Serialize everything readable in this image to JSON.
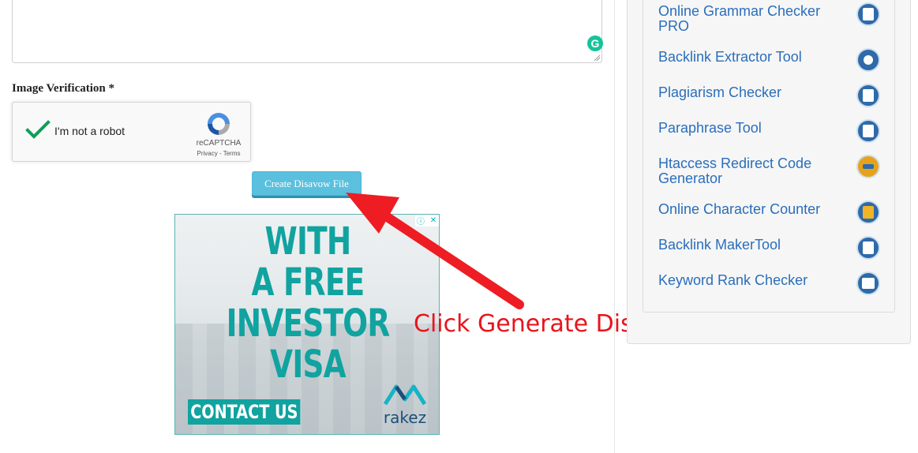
{
  "form": {
    "image_verification_label": "Image Verification *",
    "submit_label": "Create Disavow File"
  },
  "recaptcha": {
    "checkbox_label": "I'm not a robot",
    "brand": "reCAPTCHA",
    "links": "Privacy - Terms",
    "checked": true
  },
  "ad": {
    "headline_lines": [
      "WITH",
      "A FREE",
      "INVESTOR",
      "VISA"
    ],
    "cta": "CONTACT US",
    "advertiser": "rakez",
    "adchoices_icons": [
      "info-icon",
      "close-icon"
    ]
  },
  "annotation": {
    "text": "Click Generate Disavow File",
    "color": "#e8141c"
  },
  "sidebar": {
    "tools": [
      {
        "label": "Online Grammar Checker PRO",
        "icon": "grammar-checker-icon"
      },
      {
        "label": "Backlink Extractor Tool",
        "icon": "backlink-extractor-icon"
      },
      {
        "label": "Plagiarism Checker",
        "icon": "plagiarism-checker-icon"
      },
      {
        "label": "Paraphrase Tool",
        "icon": "paraphrase-tool-icon"
      },
      {
        "label": "Htaccess Redirect Code Generator",
        "icon": "htaccess-redirect-icon"
      },
      {
        "label": "Online Character Counter",
        "icon": "character-counter-icon"
      },
      {
        "label": "Backlink MakerTool",
        "icon": "backlink-maker-icon"
      },
      {
        "label": "Keyword Rank Checker",
        "icon": "keyword-rank-icon"
      }
    ]
  },
  "colors": {
    "button": "#5bc0de",
    "link": "#2a6ebb",
    "ad_teal": "#10a3a0",
    "grammarly": "#15c39a"
  }
}
